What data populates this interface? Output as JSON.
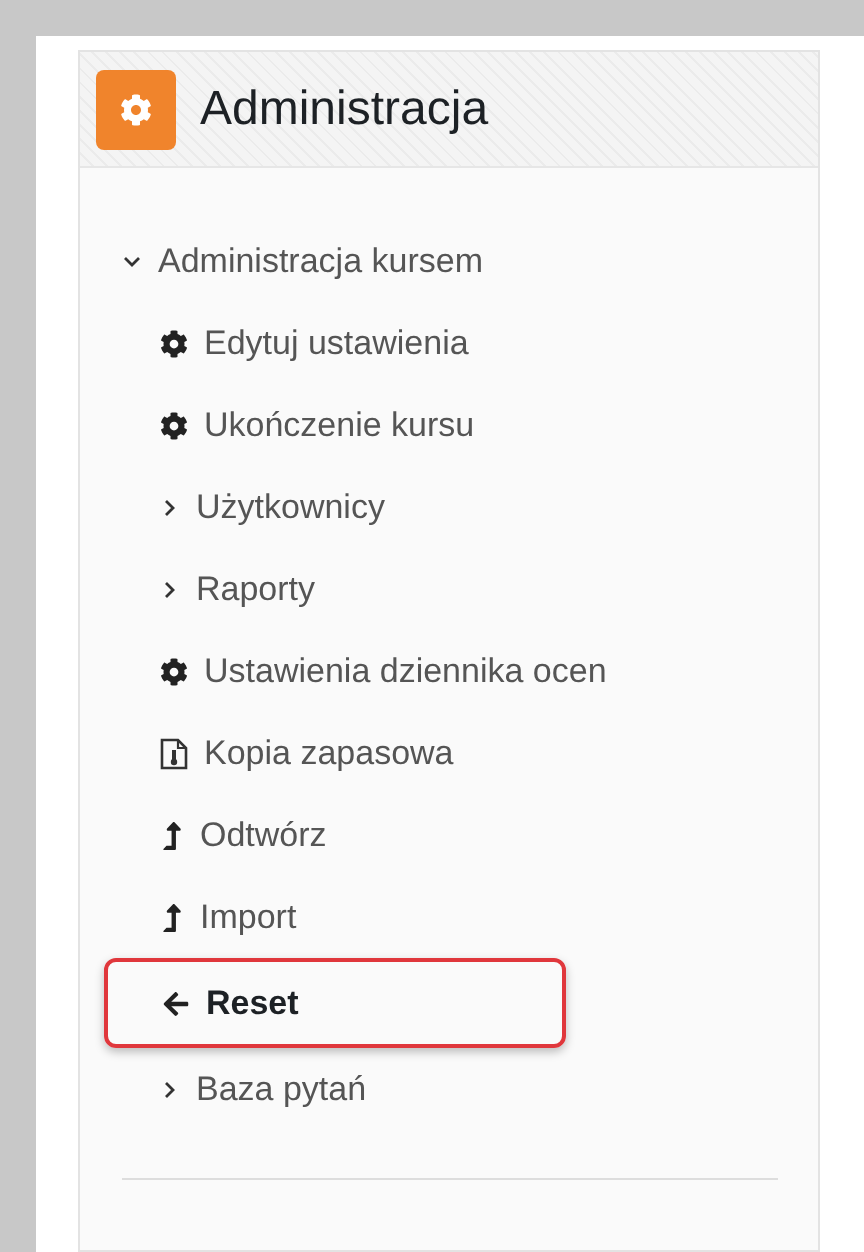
{
  "block": {
    "title": "Administracja"
  },
  "tree": [
    {
      "label": "Administracja kursem",
      "kind": "branch",
      "expanded": true,
      "children": [
        {
          "label": "Edytuj ustawienia",
          "kind": "gear",
          "selected": false
        },
        {
          "label": "Ukończenie kursu",
          "kind": "gear",
          "selected": false
        },
        {
          "label": "Użytkownicy",
          "kind": "branch",
          "expanded": false,
          "selected": false
        },
        {
          "label": "Raporty",
          "kind": "branch",
          "expanded": false,
          "selected": false
        },
        {
          "label": "Ustawienia dziennika ocen",
          "kind": "gear",
          "selected": false
        },
        {
          "label": "Kopia zapasowa",
          "kind": "backup",
          "selected": false
        },
        {
          "label": "Odtwórz",
          "kind": "restore",
          "selected": false
        },
        {
          "label": "Import",
          "kind": "restore",
          "selected": false
        },
        {
          "label": "Reset",
          "kind": "back",
          "selected": true
        },
        {
          "label": "Baza pytań",
          "kind": "branch",
          "expanded": false,
          "selected": false
        }
      ]
    }
  ]
}
